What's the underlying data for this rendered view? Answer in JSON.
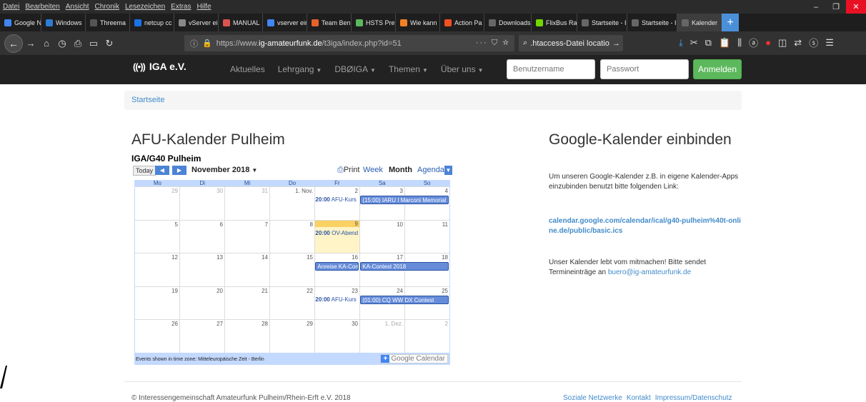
{
  "browser": {
    "menu": [
      "Datei",
      "Bearbeiten",
      "Ansicht",
      "Chronik",
      "Lesezeichen",
      "Extras",
      "Hilfe"
    ],
    "tabs": [
      {
        "label": "Google Ne",
        "color": "#4285f4"
      },
      {
        "label": "Windows",
        "color": "#2d7dd2"
      },
      {
        "label": "Threema",
        "color": "#555555"
      },
      {
        "label": "netcup cc",
        "color": "#1a73e8"
      },
      {
        "label": "vServer einrich",
        "color": "#888888"
      },
      {
        "label": "MANUAL",
        "color": "#d9534f"
      },
      {
        "label": "vserver ein",
        "color": "#4285f4"
      },
      {
        "label": "Team Ben",
        "color": "#e8612c"
      },
      {
        "label": "HSTS Prel",
        "color": "#5cb85c"
      },
      {
        "label": "Wie kann",
        "color": "#f48024"
      },
      {
        "label": "Action Pa",
        "color": "#f25022"
      },
      {
        "label": "Downloads",
        "color": "#666666"
      },
      {
        "label": "FlixBus Ra",
        "color": "#73d700"
      },
      {
        "label": "Startseite - Inte",
        "color": "#666666"
      },
      {
        "label": "Startseite - Inte",
        "color": "#666666"
      },
      {
        "label": "Kalender",
        "color": "#666666"
      }
    ],
    "url_prefix": "https://www.",
    "url_host": "ig-amateurfunk.de",
    "url_path": "/t3iga/index.php?id=51",
    "search_value": ".htaccess-Datei locatio"
  },
  "site": {
    "logo_text": "IGA e.V.",
    "nav": [
      {
        "label": "Aktuelles",
        "dropdown": false
      },
      {
        "label": "Lehrgang",
        "dropdown": true
      },
      {
        "label": "DBØIGA",
        "dropdown": true
      },
      {
        "label": "Themen",
        "dropdown": true
      },
      {
        "label": "Über uns",
        "dropdown": true
      }
    ],
    "username_placeholder": "Benutzername",
    "password_placeholder": "Passwort",
    "login_label": "Anmelden",
    "breadcrumb": "Startseite"
  },
  "main": {
    "title": "AFU-Kalender Pulheim"
  },
  "calendar": {
    "title": "IGA/G40 Pulheim",
    "today_label": "Today",
    "month_label": "November 2018",
    "print_label": "Print",
    "views": [
      "Week",
      "Month",
      "Agenda"
    ],
    "active_view": "Month",
    "day_headers": [
      "Mo",
      "Di",
      "Mi",
      "Do",
      "Fr",
      "Sa",
      "So"
    ],
    "weeks": [
      [
        "29",
        "30",
        "31",
        "1. Nov.",
        "2",
        "3",
        "4"
      ],
      [
        "5",
        "6",
        "7",
        "8",
        "9",
        "10",
        "11"
      ],
      [
        "12",
        "13",
        "14",
        "15",
        "16",
        "17",
        "18"
      ],
      [
        "19",
        "20",
        "21",
        "22",
        "23",
        "24",
        "25"
      ],
      [
        "26",
        "27",
        "28",
        "29",
        "30",
        "1. Dez.",
        "2"
      ]
    ],
    "today": "9",
    "events": [
      {
        "week": 0,
        "day": 4,
        "span": 1,
        "time": "20:00",
        "title": "AFU-Kurs",
        "kind": "timed"
      },
      {
        "week": 0,
        "day": 5,
        "span": 2,
        "time": "",
        "title": "(15:00) IARU I Marconi Memorial",
        "kind": "bar"
      },
      {
        "week": 1,
        "day": 4,
        "span": 1,
        "time": "20:00",
        "title": "OV-Abend",
        "kind": "timed"
      },
      {
        "week": 2,
        "day": 4,
        "span": 1,
        "time": "",
        "title": "Anreise KA-Contest",
        "kind": "bar"
      },
      {
        "week": 2,
        "day": 5,
        "span": 2,
        "time": "",
        "title": "KA-Contest 2018",
        "kind": "bar"
      },
      {
        "week": 3,
        "day": 4,
        "span": 1,
        "time": "20:00",
        "title": "AFU-Kurs",
        "kind": "timed"
      },
      {
        "week": 3,
        "day": 5,
        "span": 2,
        "time": "",
        "title": "(01:00) CQ WW DX Contest",
        "kind": "bar"
      }
    ],
    "timezone_note": "Events shown in time zone: Mitteleuropäische Zeit - Berlin",
    "gcal_label": "Google Calendar"
  },
  "sidebar": {
    "title": "Google-Kalender einbinden",
    "intro": "Um unseren Google-Kalender z.B. in eigene Kalender-Apps einzubinden benutzt bitte folgenden Link:",
    "ical_link": "calendar.google.com/calendar/ical/g40-pulheim%40t-online.de/public/basic.ics",
    "note": "Unser Kalender lebt vom mitmachen! Bitte sendet Termineinträge an",
    "email": "buero@ig-amateurfunk.de"
  },
  "footer": {
    "copyright": "© Interessengemeinschaft Amateurfunk Pulheim/Rhein-Erft e.V. 2018",
    "links": [
      "Soziale Netzwerke",
      "Kontakt",
      "Impressum/Datenschutz"
    ]
  }
}
